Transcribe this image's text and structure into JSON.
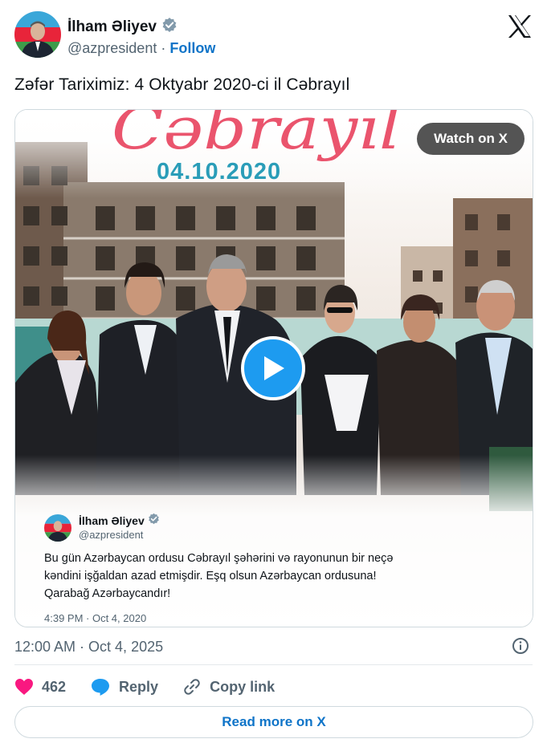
{
  "author": {
    "name": "İlham Əliyev",
    "handle": "@azpresident",
    "separator": "·",
    "follow_label": "Follow"
  },
  "tweet": {
    "text": "Zəfər Tariximiz: 4 Oktyabr 2020-ci il Cəbrayıl",
    "timestamp": "12:00 AM · Oct 4, 2025"
  },
  "media": {
    "title_script": "Cəbrayıl",
    "date_text": "04.10.2020",
    "watch_label": "Watch on X"
  },
  "quoted_tweet": {
    "name": "İlham Əliyev",
    "handle": "@azpresident",
    "body": "Bu gün Azərbaycan ordusu Cəbrayıl şəhərini  və rayonunun bir neçə kəndini işğaldan azad etmişdir. Eşq olsun Azərbaycan ordusuna! Qarabağ Azərbaycandır!",
    "time": "4:39 PM · Oct 4, 2020"
  },
  "actions": {
    "like_count": "462",
    "reply_label": "Reply",
    "copy_link_label": "Copy link"
  },
  "read_more_label": "Read more on X",
  "colors": {
    "accent": "#1d9bf0",
    "link": "#0f74c8",
    "like": "#f91880",
    "muted": "#536471",
    "title_red": "#e8425e",
    "date_teal": "#2a9db8"
  },
  "icons": [
    "verified-badge-icon",
    "x-logo-icon",
    "play-icon",
    "info-icon",
    "heart-icon",
    "reply-bubble-icon",
    "link-icon"
  ]
}
